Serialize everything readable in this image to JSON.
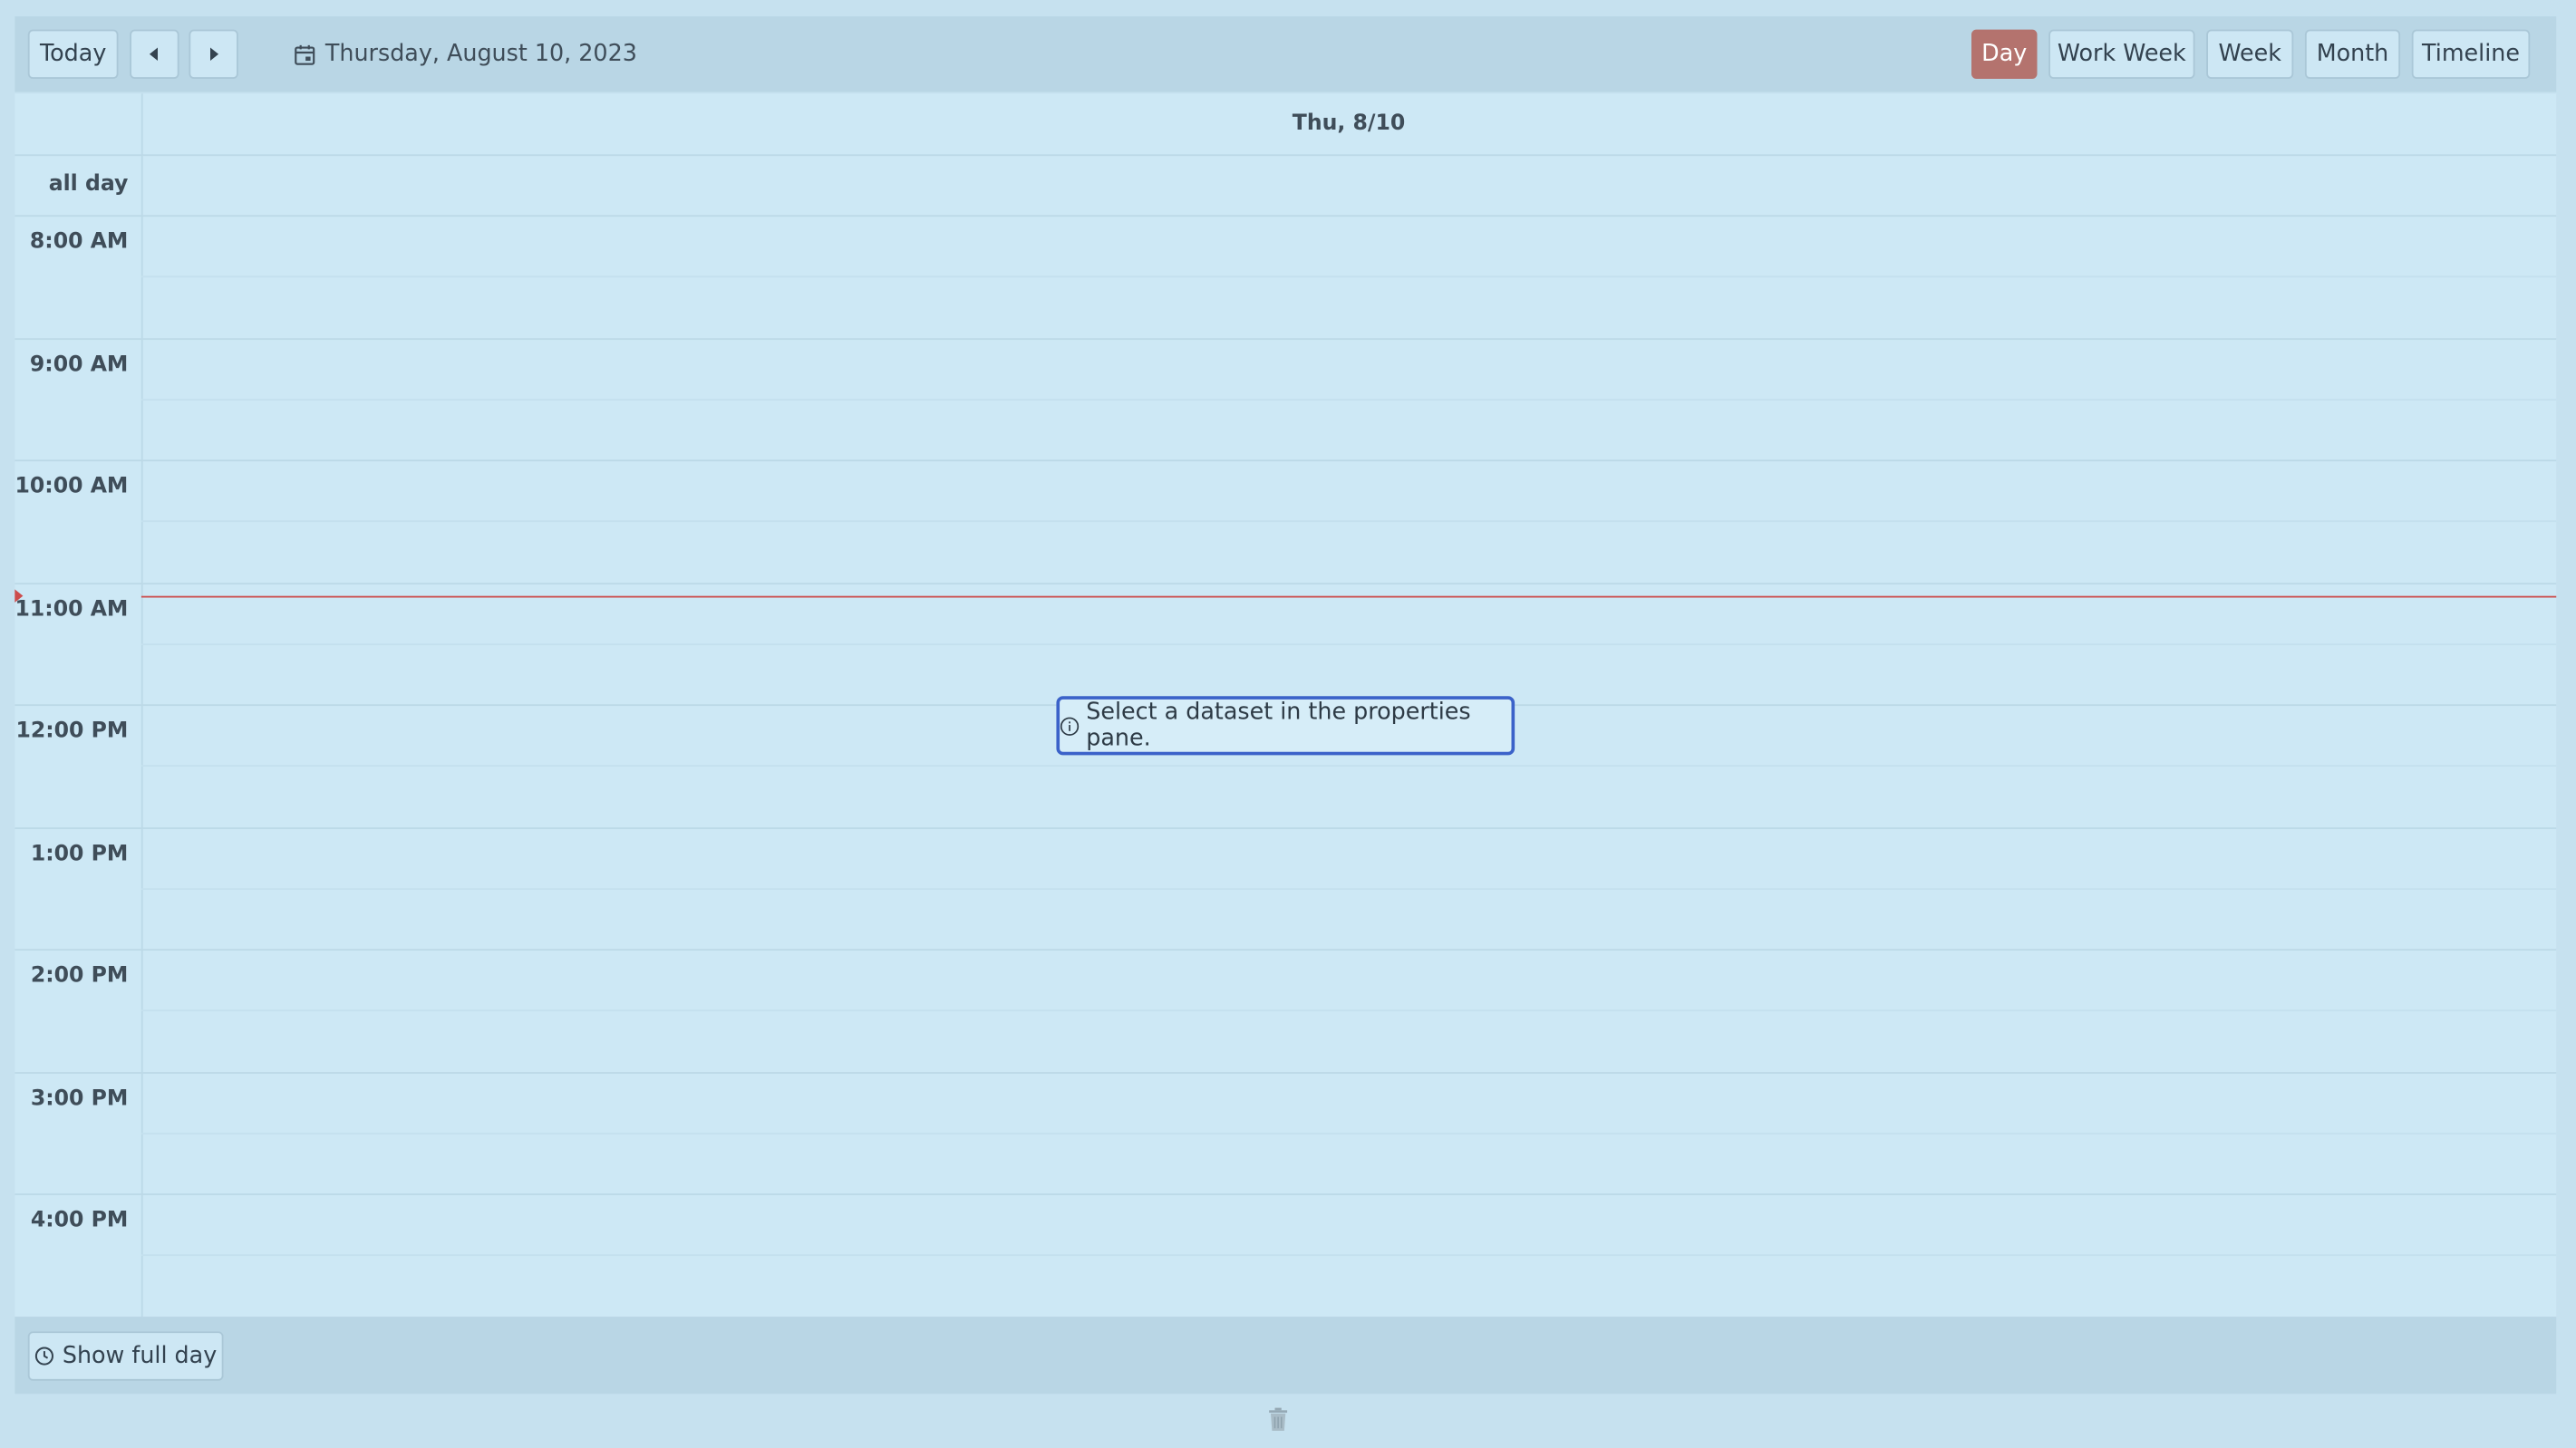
{
  "toolbar": {
    "today_label": "Today",
    "prev_icon": "triangle-left-icon",
    "next_icon": "triangle-right-icon",
    "date_text": "Thursday, August 10, 2023",
    "views": [
      "Day",
      "Work Week",
      "Week",
      "Month",
      "Timeline"
    ],
    "active_view": "Day",
    "active_color": "#b4736e"
  },
  "grid": {
    "day_header": "Thu, 8/10",
    "all_day_label": "all day",
    "hours": [
      "8:00 AM",
      "9:00 AM",
      "10:00 AM",
      "11:00 AM",
      "12:00 PM",
      "1:00 PM",
      "2:00 PM",
      "3:00 PM",
      "4:00 PM"
    ],
    "now_indicator_color": "#cc4c4c"
  },
  "notice": {
    "text": "Select a dataset in the properties pane.",
    "icon": "info-circle-icon"
  },
  "footer": {
    "show_full_day_label": "Show full day",
    "icon": "clock-icon"
  },
  "bottom": {
    "icon": "trash-icon"
  }
}
